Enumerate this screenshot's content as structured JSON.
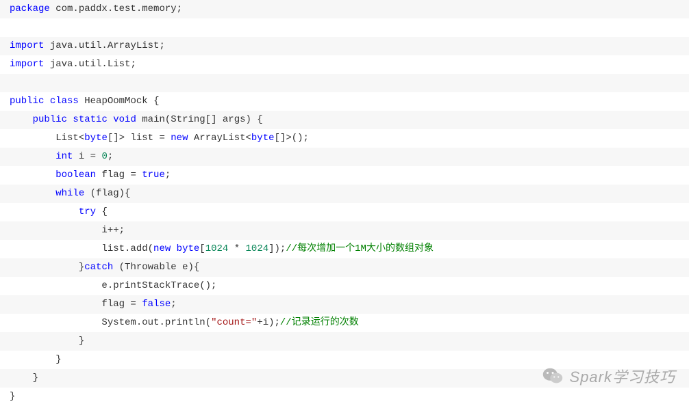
{
  "watermark": "Spark学习技巧",
  "code": {
    "l1": {
      "kw1": "package",
      "pkg": " com.paddx.test.memory;"
    },
    "l3": {
      "kw1": "import",
      "pkg": " java.util.ArrayList;"
    },
    "l4": {
      "kw1": "import",
      "pkg": " java.util.List;"
    },
    "l6": {
      "kw1": "public",
      "kw2": " class",
      "cls": " HeapOomMock",
      "punct": " {"
    },
    "l7": {
      "indent": "    ",
      "kw1": "public",
      "kw2": " static",
      "kw3": " void",
      "method": " main",
      "p1": "(String[] args) {"
    },
    "l8": {
      "indent": "        ",
      "type1": "List",
      "g1": "<",
      "kw1": "byte",
      "g2": "[]> list = ",
      "kw2": "new",
      "type2": " ArrayList",
      "g3": "<",
      "kw3": "byte",
      "g4": "[]>();"
    },
    "l9": {
      "indent": "        ",
      "kw1": "int",
      "t1": " i = ",
      "num": "0",
      "t2": ";"
    },
    "l10": {
      "indent": "        ",
      "kw1": "boolean",
      "t1": " flag = ",
      "kw2": "true",
      "t2": ";"
    },
    "l11": {
      "indent": "        ",
      "kw1": "while",
      "t1": " (flag){"
    },
    "l12": {
      "indent": "            ",
      "kw1": "try",
      "t1": " {"
    },
    "l13": {
      "indent": "                ",
      "t1": "i++;"
    },
    "l14": {
      "indent": "                ",
      "t1": "list.add(",
      "kw1": "new",
      "t2": " ",
      "kw2": "byte",
      "t3": "[",
      "n1": "1024",
      "t4": " * ",
      "n2": "1024",
      "t5": "]);",
      "cm": "//每次增加一个1M大小的数组对象"
    },
    "l15": {
      "indent": "            ",
      "t1": "}",
      "kw1": "catch",
      "t2": " (Throwable e){"
    },
    "l16": {
      "indent": "                ",
      "t1": "e.printStackTrace();"
    },
    "l17": {
      "indent": "                ",
      "t1": "flag = ",
      "kw1": "false",
      "t2": ";"
    },
    "l18": {
      "indent": "                ",
      "t1": "System.",
      "kw1": "out",
      "t2": ".println(",
      "str": "\"count=\"",
      "t3": "+i);",
      "cm": "//记录运行的次数"
    },
    "l19": {
      "indent": "            ",
      "t1": "}"
    },
    "l20": {
      "indent": "        ",
      "t1": "}"
    },
    "l21": {
      "indent": "    ",
      "t1": "}"
    },
    "l22": {
      "t1": "}"
    }
  }
}
